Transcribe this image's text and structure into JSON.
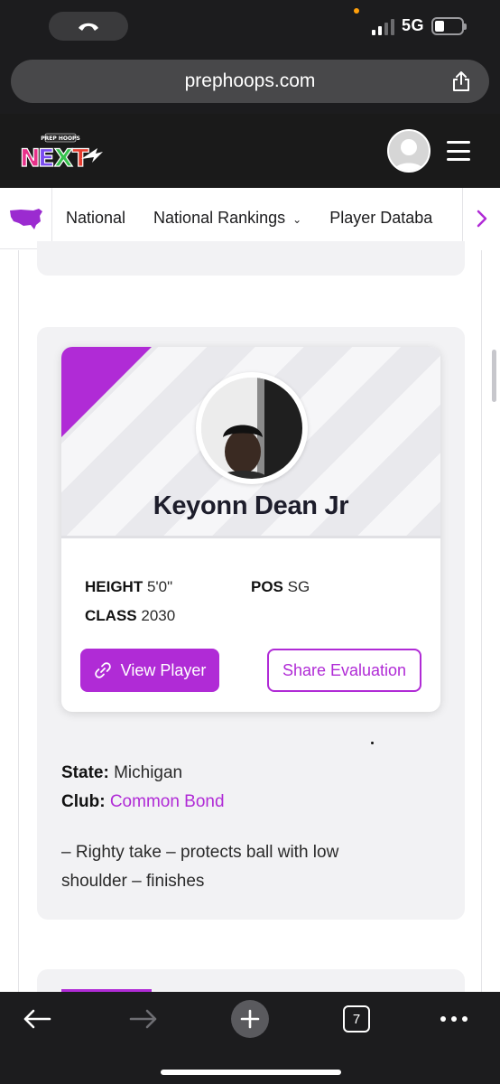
{
  "browser": {
    "network": "5G",
    "url": "prephoops.com",
    "tab_count": "7"
  },
  "site": {
    "logo_top_text": "PREP HOOPS",
    "logo_text": "NEXT"
  },
  "nav": {
    "items": [
      {
        "label": "National"
      },
      {
        "label": "National Rankings"
      },
      {
        "label": "Player Databa"
      }
    ]
  },
  "player": {
    "name": "Keyonn Dean Jr",
    "height_label": "HEIGHT",
    "height_value": "5'0\"",
    "pos_label": "POS",
    "pos_value": "SG",
    "class_label": "CLASS",
    "class_value": "2030",
    "view_button": "View Player",
    "share_button": "Share Evaluation",
    "state_label": "State:",
    "state_value": "Michigan",
    "club_label": "Club:",
    "club_value": "Common Bond",
    "description": "– Righty take – protects ball with low shoulder – finishes"
  },
  "colors": {
    "accent": "#b02bd6",
    "header_bg": "#1a1a1a",
    "card_bg": "#f2f2f4"
  }
}
